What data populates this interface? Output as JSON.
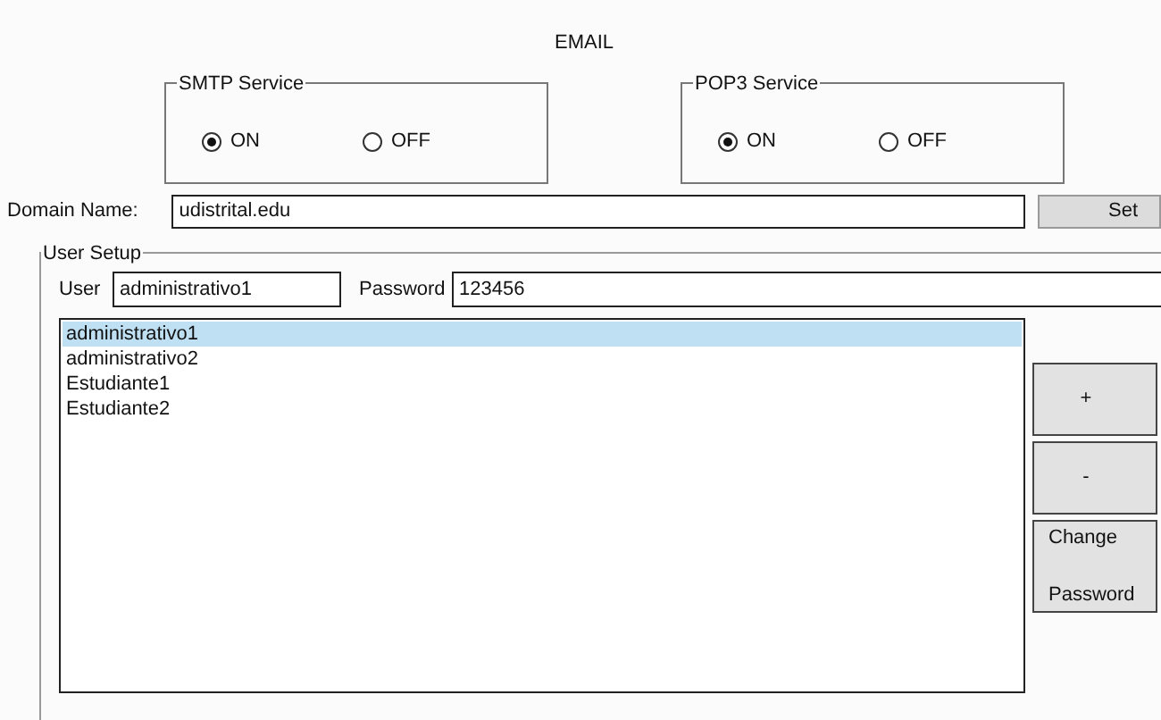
{
  "title": "EMAIL",
  "services": [
    {
      "legend": "SMTP Service",
      "options": [
        {
          "label": "ON",
          "selected": true
        },
        {
          "label": "OFF",
          "selected": false
        }
      ]
    },
    {
      "legend": "POP3 Service",
      "options": [
        {
          "label": "ON",
          "selected": true
        },
        {
          "label": "OFF",
          "selected": false
        }
      ]
    }
  ],
  "domain": {
    "label": "Domain Name:",
    "value": "udistrital.edu",
    "button": "Set"
  },
  "user_setup": {
    "legend": "User Setup",
    "user_label": "User",
    "user_value": "administrativo1",
    "password_label": "Password",
    "password_value": "123456",
    "users": [
      {
        "name": "administrativo1",
        "selected": true
      },
      {
        "name": "administrativo2",
        "selected": false
      },
      {
        "name": "Estudiante1",
        "selected": false
      },
      {
        "name": "Estudiante2",
        "selected": false
      }
    ],
    "buttons": [
      {
        "label": "+",
        "kind": "single"
      },
      {
        "label": "-",
        "kind": "single"
      },
      {
        "label": "Change",
        "label_2": "Password",
        "kind": "double"
      }
    ]
  }
}
